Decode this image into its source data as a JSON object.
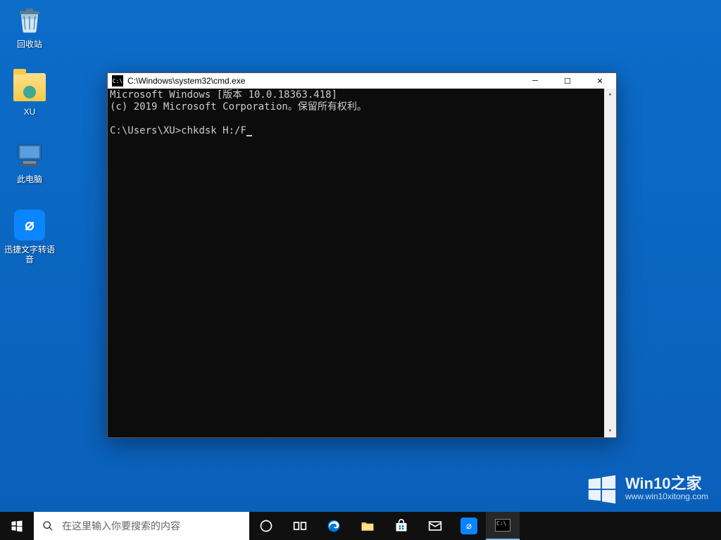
{
  "desktop": {
    "icons": [
      {
        "name": "recycle-bin",
        "label": "回收站"
      },
      {
        "name": "folder-xu",
        "label": "XU"
      },
      {
        "name": "this-pc",
        "label": "此电脑"
      },
      {
        "name": "tts-app",
        "label": "迅捷文字转语音"
      }
    ]
  },
  "cmd": {
    "title": "C:\\Windows\\system32\\cmd.exe",
    "line1": "Microsoft Windows [版本 10.0.18363.418]",
    "line2": "(c) 2019 Microsoft Corporation。保留所有权利。",
    "prompt": "C:\\Users\\XU>",
    "command": "chkdsk H:/F"
  },
  "watermark": {
    "title": "Win10之家",
    "url": "www.win10xitong.com"
  },
  "taskbar": {
    "search_placeholder": "在这里输入你要搜索的内容"
  }
}
